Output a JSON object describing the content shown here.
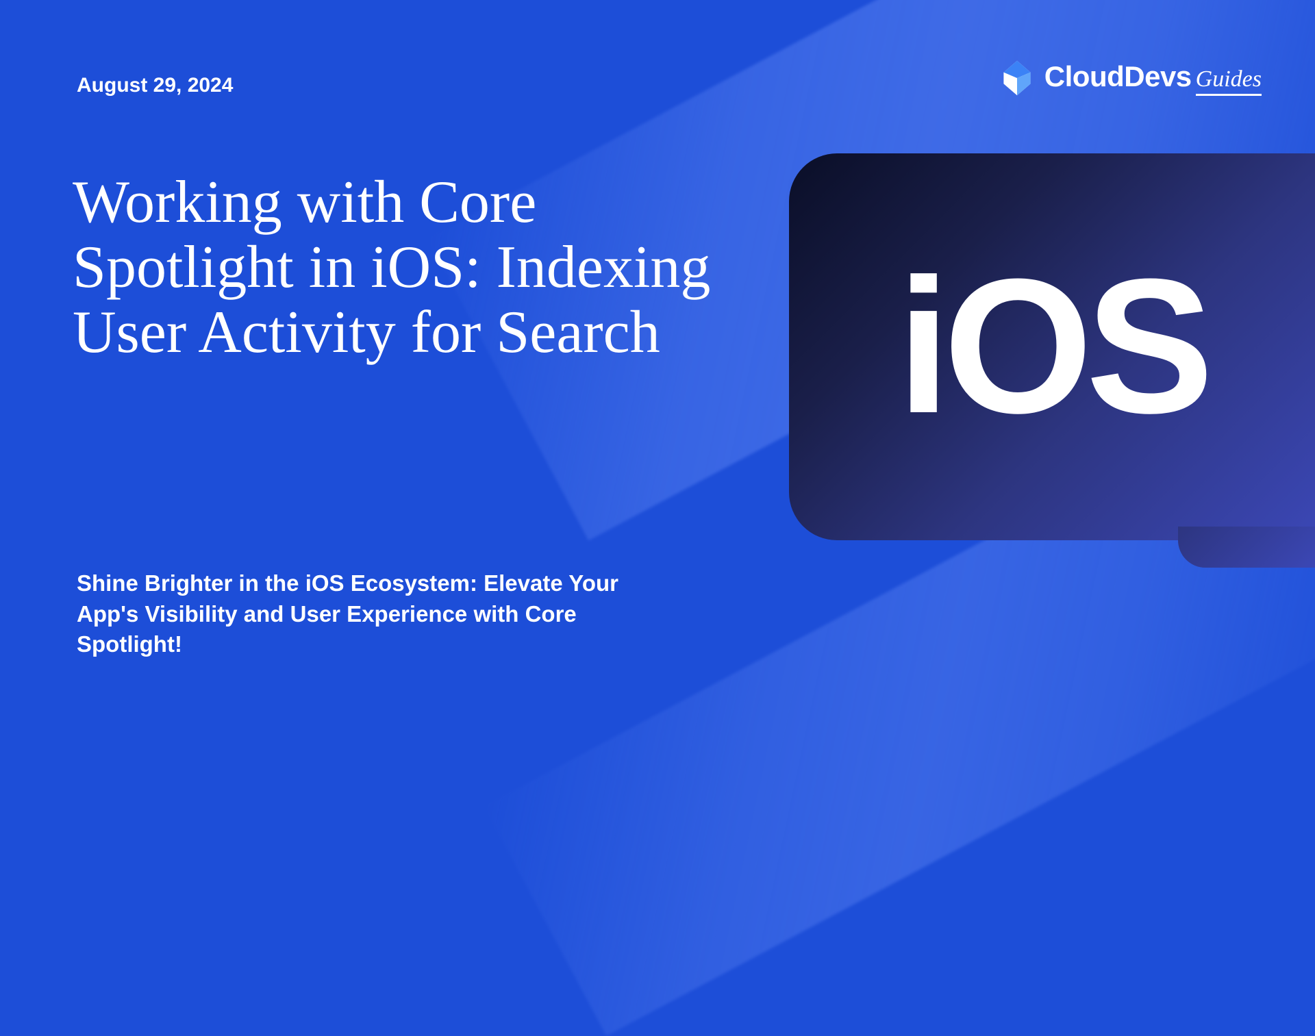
{
  "date": "August 29, 2024",
  "brand": {
    "name": "CloudDevs",
    "sub": "Guides"
  },
  "title": "Working with Core Spotlight in iOS: Indexing User Activity for Search",
  "subtitle": "Shine Brighter in the iOS Ecosystem: Elevate Your App's Visibility and User Experience with Core Spotlight!",
  "badge": {
    "text": "iOS"
  }
}
